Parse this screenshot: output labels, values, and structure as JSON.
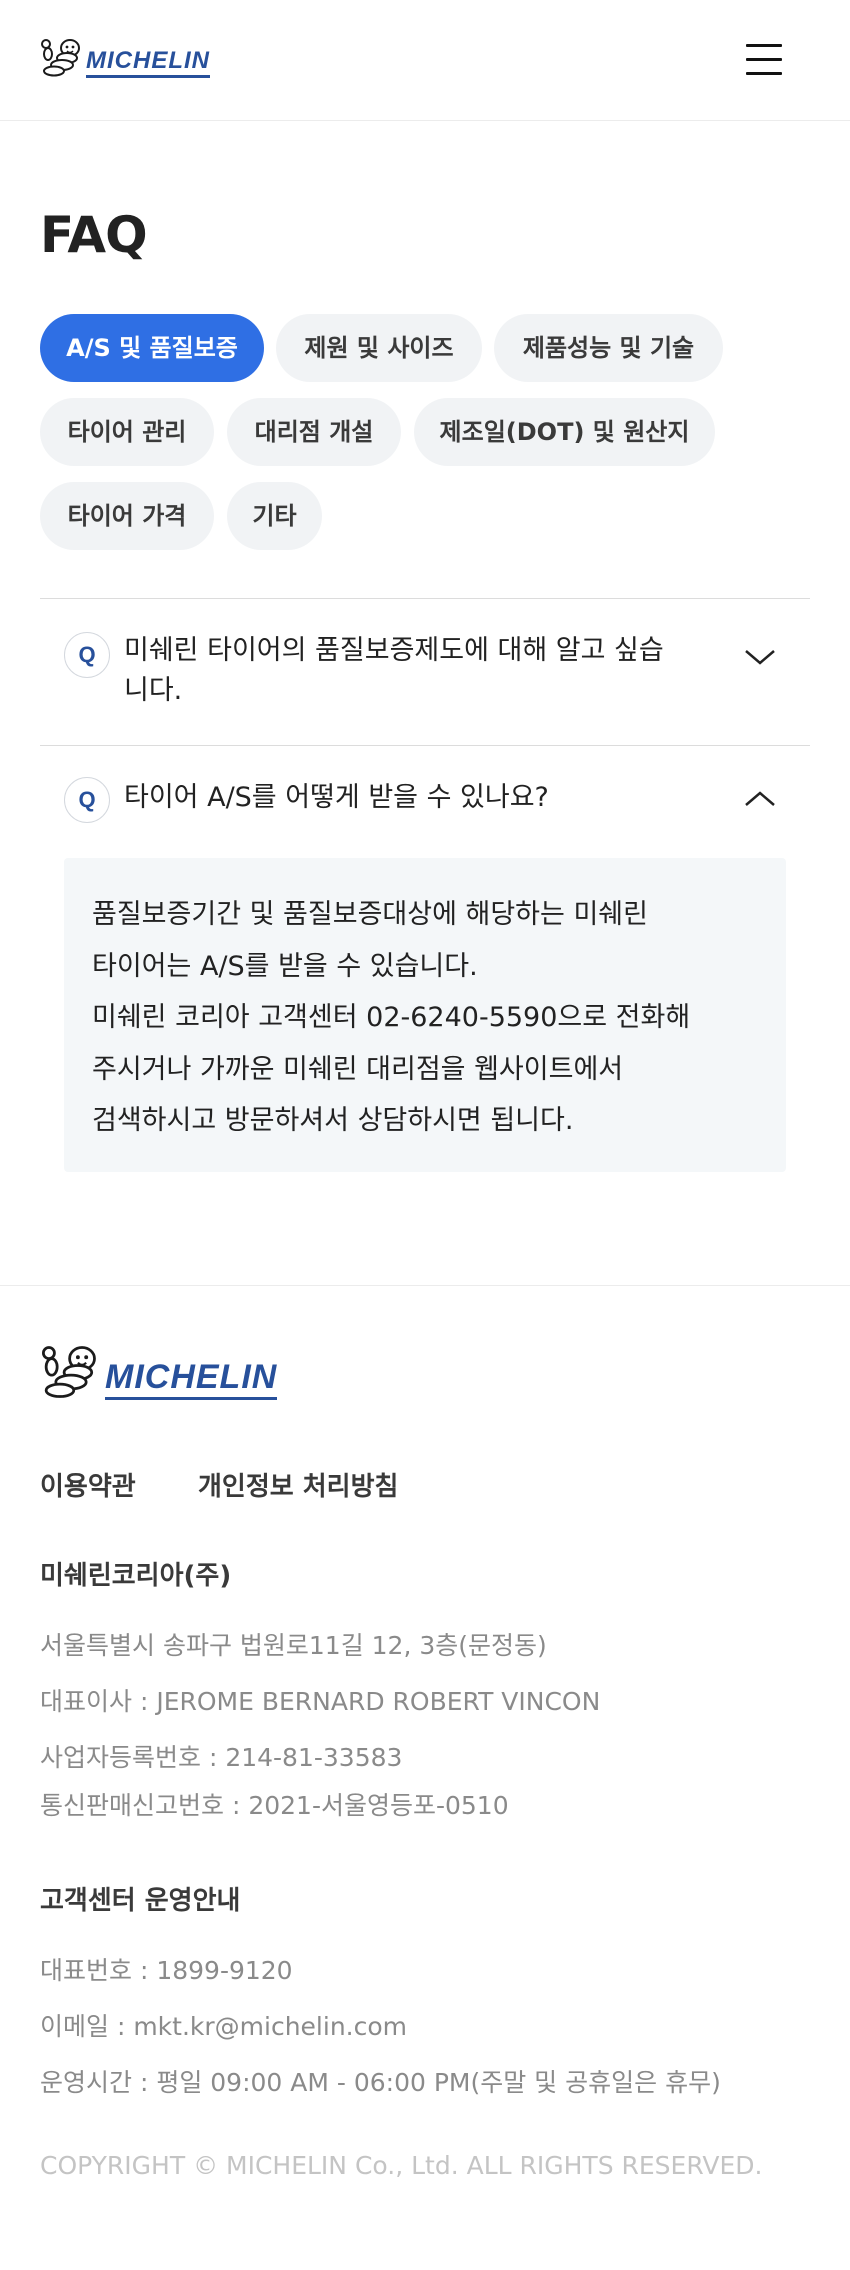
{
  "header": {
    "logo_text": "MICHELIN",
    "menu_icon": "hamburger-menu-icon"
  },
  "page": {
    "title": "FAQ"
  },
  "categories": [
    {
      "label": "A/S 및 품질보증",
      "active": true
    },
    {
      "label": "제원 및 사이즈",
      "active": false
    },
    {
      "label": "제품성능 및 기술",
      "active": false
    },
    {
      "label": "타이어 관리",
      "active": false
    },
    {
      "label": "대리점 개설",
      "active": false
    },
    {
      "label": "제조일(DOT) 및 원산지",
      "active": false
    },
    {
      "label": "타이어 가격",
      "active": false
    },
    {
      "label": "기타",
      "active": false
    }
  ],
  "faq": [
    {
      "badge": "Q",
      "question": "미쉐린 타이어의 품질보증제도에 대해 알고 싶습니다.",
      "expanded": false,
      "icon": "chevron-down-icon"
    },
    {
      "badge": "Q",
      "question": "타이어 A/S를 어떻게 받을 수 있나요?",
      "expanded": true,
      "icon": "chevron-up-icon",
      "answer_lines": [
        "품질보증기간 및 품질보증대상에 해당하는 미쉐린",
        "타이어는 A/S를 받을 수 있습니다.",
        "미쉐린 코리아 고객센터 02-6240-5590으로 전화해",
        "주시거나 가까운 미쉐린 대리점을 웹사이트에서",
        "검색하시고 방문하셔서 상담하시면 됩니다."
      ]
    }
  ],
  "footer": {
    "logo_text": "MICHELIN",
    "links": [
      "이용약관",
      "개인정보 처리방침"
    ],
    "company": {
      "name": "미쉐린코리아(주)",
      "address": "서울특별시 송파구 법원로11길 12, 3층(문정동)",
      "ceo": "대표이사 : JEROME BERNARD ROBERT VINCON",
      "business_reg": "사업자등록번호 : 214-81-33583",
      "mail_order_reg": "통신판매신고번호 : 2021-서울영등포-0510"
    },
    "support": {
      "heading": "고객센터 운영안내",
      "phone": "대표번호 : 1899-9120",
      "email": "이메일 : mkt.kr@michelin.com",
      "hours": "운영시간 : 평일 09:00 AM - 06:00 PM(주말 및 공휴일은 휴무)"
    },
    "copyright": "COPYRIGHT © MICHELIN Co., Ltd. ALL RIGHTS RESERVED."
  },
  "colors": {
    "brand_blue": "#27509b",
    "chip_active": "#2f6fe4",
    "chip_inactive": "#f1f3f5",
    "answer_bg": "#f4f7f9"
  }
}
